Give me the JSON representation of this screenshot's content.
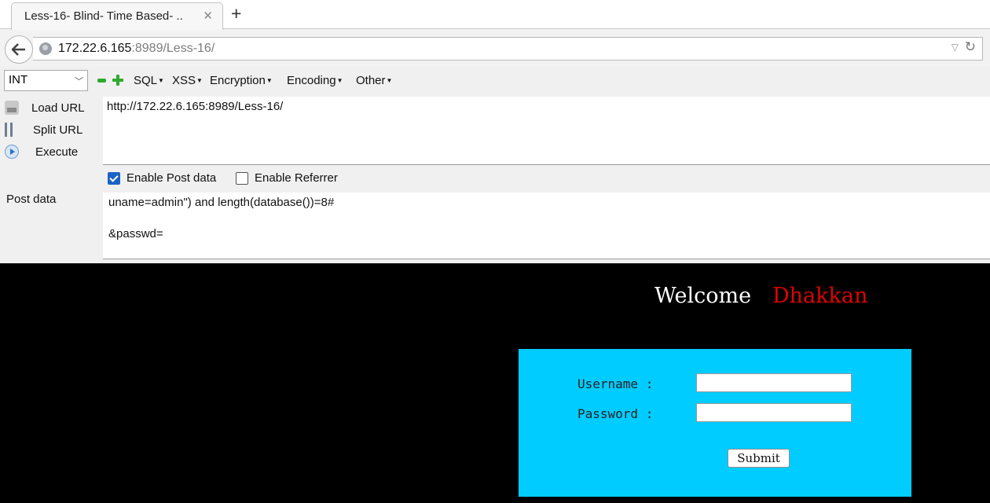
{
  "browser": {
    "tab_title": "Less-16- Blind- Time Based- ..",
    "tab_close": "✕",
    "new_tab": "+",
    "url_host": "172.22.6.165",
    "url_rest": ":8989/Less-16/"
  },
  "hackbar": {
    "type_value": "INT",
    "menus": [
      "SQL",
      "XSS",
      "Encryption",
      "Encoding",
      "Other"
    ],
    "actions": {
      "load": "Load URL",
      "split": "Split URL",
      "execute": "Execute"
    },
    "url_text": "http://172.22.6.165:8989/Less-16/",
    "enable_post": {
      "label": "Enable Post data",
      "checked": true
    },
    "enable_referrer": {
      "label": "Enable Referrer",
      "checked": false
    },
    "post_label": "Post data",
    "post_line1": "uname=admin\") and length(database())=8#",
    "post_line2": "&passwd="
  },
  "page": {
    "welcome": "Welcome",
    "name": "Dhakkan",
    "username_label": "Username :",
    "password_label": "Password :",
    "submit": "Submit"
  },
  "colors": {
    "background": "#000000",
    "accent_name": "#e00000",
    "login_box": "#00ccff"
  }
}
